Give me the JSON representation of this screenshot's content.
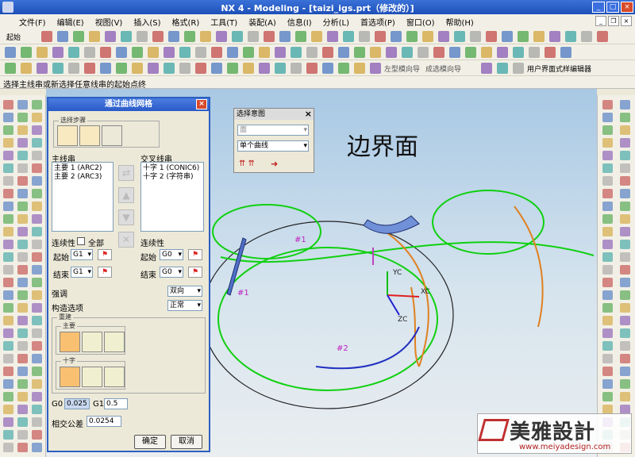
{
  "window": {
    "title": "NX 4 - Modeling - [taizi_igs.prt（修改的）]"
  },
  "menu": [
    "文件(F)",
    "编辑(E)",
    "视图(V)",
    "插入(S)",
    "格式(R)",
    "工具(T)",
    "装配(A)",
    "信息(I)",
    "分析(L)",
    "首选项(P)",
    "窗口(O)",
    "帮助(H)"
  ],
  "toolbar1": {
    "start_label": "起始"
  },
  "prompt": "选择主线串或新选择任意线串的起始点终",
  "toolbar_text": {
    "select_guide": "左型模向导",
    "select_guide2": "成选模向导",
    "ui_detail": "用户界面式样编辑器"
  },
  "dialog": {
    "title": "通过曲线网格",
    "select_step": "选择步骤",
    "primary_label": "主线串",
    "cross_label": "交叉线串",
    "primary_items": [
      "主要 1 (ARC2)",
      "主要 2 (ARC3)"
    ],
    "cross_items": [
      "十字 1 (CONIC6)",
      "十字 2 (字符串)"
    ],
    "continuity_left": "连续性",
    "all_label": "全部",
    "continuity_right": "连续性",
    "start_label_l": "起始",
    "end_label_l": "结束",
    "start_label_r": "起始",
    "end_label_r": "结束",
    "start_val_l": "G1",
    "end_val_l": "G1",
    "start_val_r": "G0",
    "end_val_r": "G0",
    "emphasis_label": "强调",
    "emphasis_value": "双向",
    "build_label": "构造选项",
    "build_value": "正常",
    "redisplay_label": "重建",
    "primary_group": "主要",
    "cross_group": "十字",
    "g0_label": "G0",
    "g0_value": "0.025",
    "g1_label": "G1",
    "g1_value": "0.5",
    "tol_label": "相交公差",
    "tol_value": "0.0254",
    "ok_label": "确定",
    "cancel_label": "取消"
  },
  "selbar": {
    "title": "选择意图",
    "combo1": "面",
    "combo2": "单个曲线"
  },
  "viewport": {
    "big_label": "边界面",
    "curve_labels": [
      "#1",
      "#1",
      "#2"
    ],
    "axis_labels": [
      "YC",
      "XC",
      "ZC"
    ]
  },
  "watermark": {
    "text": "美雅設計",
    "url": "www.meiyadesign.com"
  },
  "colors": {
    "curve_green": "#10d010",
    "curve_orange": "#e08020",
    "curve_blue": "#2030c0",
    "surface": "#7090d8"
  }
}
